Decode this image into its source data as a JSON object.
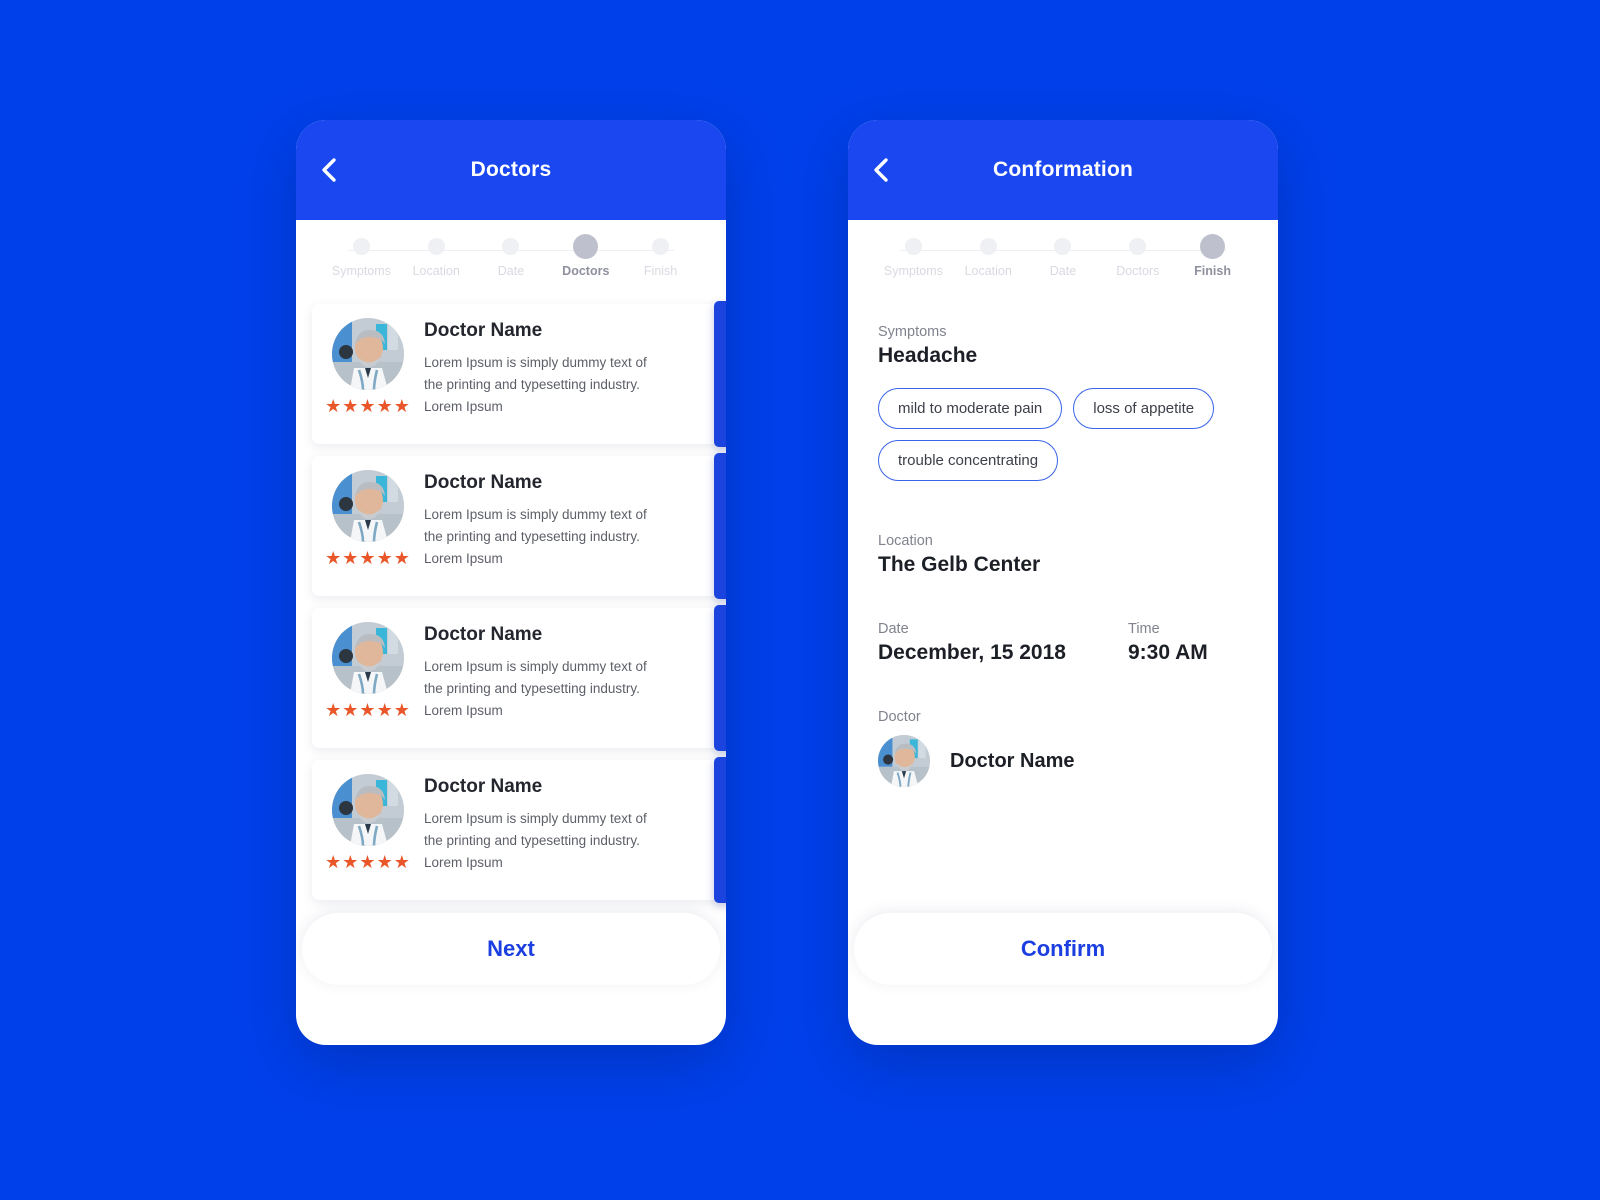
{
  "theme": {
    "background": "#0040EB",
    "header_blue": "#1A47F0",
    "accent_blue": "#1B44DE",
    "cta_text_blue": "#1B3FE0",
    "star_orange": "#E8562A",
    "chip_border": "#3A63E8",
    "step_active_dot": "#BEC0CD",
    "step_inactive_dot": "#EFF0F4"
  },
  "left_phone": {
    "header": {
      "title": "Doctors",
      "back_icon": "chevron-left-icon"
    },
    "stepper": {
      "steps": [
        {
          "label": "Symptoms",
          "active": false
        },
        {
          "label": "Location",
          "active": false
        },
        {
          "label": "Date",
          "active": false
        },
        {
          "label": "Doctors",
          "active": true
        },
        {
          "label": "Finish",
          "active": false
        }
      ]
    },
    "doctors": [
      {
        "name": "Doctor Name",
        "description": "Lorem Ipsum is simply dummy text of the printing and typesetting industry. Lorem Ipsum",
        "stars": "★★★★★",
        "rating": 5,
        "chevron_icon": "chevron-right-icon"
      },
      {
        "name": "Doctor Name",
        "description": "Lorem Ipsum is simply dummy text of the printing and typesetting industry. Lorem Ipsum",
        "stars": "★★★★★",
        "rating": 5,
        "chevron_icon": "chevron-right-icon"
      },
      {
        "name": "Doctor Name",
        "description": "Lorem Ipsum is simply dummy text of the printing and typesetting industry. Lorem Ipsum",
        "stars": "★★★★★",
        "rating": 5,
        "chevron_icon": "chevron-right-icon"
      },
      {
        "name": "Doctor Name",
        "description": "Lorem Ipsum is simply dummy text of the printing and typesetting industry. Lorem Ipsum",
        "stars": "★★★★★",
        "rating": 5,
        "chevron_icon": "chevron-right-icon"
      }
    ],
    "cta": {
      "label": "Next"
    }
  },
  "right_phone": {
    "header": {
      "title": "Conformation",
      "back_icon": "chevron-left-icon"
    },
    "stepper": {
      "steps": [
        {
          "label": "Symptoms",
          "active": false
        },
        {
          "label": "Location",
          "active": false
        },
        {
          "label": "Date",
          "active": false
        },
        {
          "label": "Doctors",
          "active": false
        },
        {
          "label": "Finish",
          "active": true
        }
      ]
    },
    "summary": {
      "symptoms_label": "Symptoms",
      "symptoms_value": "Headache",
      "symptom_tags": [
        "mild to moderate pain",
        "loss of appetite",
        "trouble concentrating"
      ],
      "location_label": "Location",
      "location_value": "The Gelb Center",
      "date_label": "Date",
      "date_value": "December, 15 2018",
      "time_label": "Time",
      "time_value": "9:30 AM",
      "doctor_label": "Doctor",
      "doctor_value": "Doctor Name"
    },
    "cta": {
      "label": "Confirm"
    }
  }
}
